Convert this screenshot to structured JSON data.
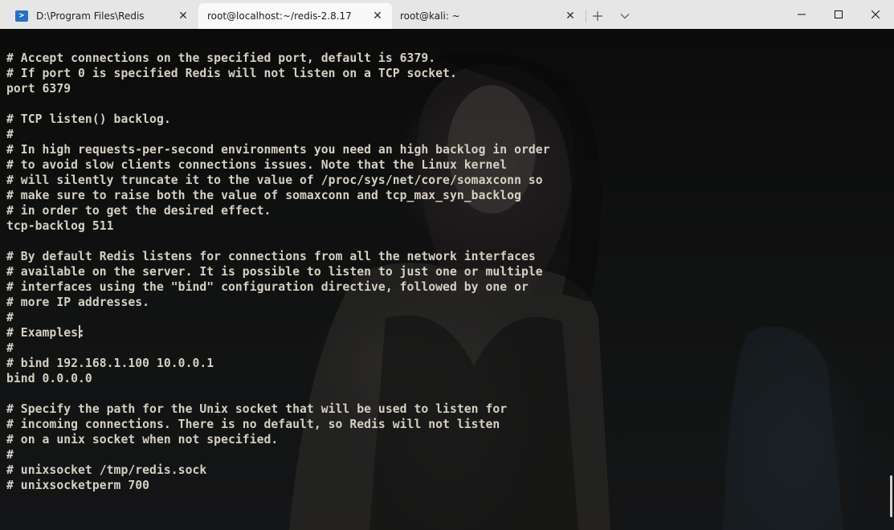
{
  "tabs": [
    {
      "label": "D:\\Program Files\\Redis",
      "icon": "powershell-icon",
      "active": false
    },
    {
      "label": "root@localhost:~/redis-2.8.17",
      "active": true
    },
    {
      "label": "root@kali: ~",
      "active": false
    }
  ],
  "tab_close_glyph": "✕",
  "ps_icon_glyph": ">",
  "colors": {
    "tabbar_bg": "#e6e6e6",
    "active_tab_bg": "#f9f9f9",
    "terminal_bg": "#0c0c0c",
    "terminal_fg": "#d6d0c2",
    "ps_icon": "#2671be"
  },
  "terminal": {
    "lines": [
      "# Accept connections on the specified port, default is 6379.",
      "# If port 0 is specified Redis will not listen on a TCP socket.",
      "port 6379",
      "",
      "# TCP listen() backlog.",
      "#",
      "# In high requests-per-second environments you need an high backlog in order",
      "# to avoid slow clients connections issues. Note that the Linux kernel",
      "# will silently truncate it to the value of /proc/sys/net/core/somaxconn so",
      "# make sure to raise both the value of somaxconn and tcp_max_syn_backlog",
      "# in order to get the desired effect.",
      "tcp-backlog 511",
      "",
      "# By default Redis listens for connections from all the network interfaces",
      "# available on the server. It is possible to listen to just one or multiple",
      "# interfaces using the \"bind\" configuration directive, followed by one or",
      "# more IP addresses.",
      "#",
      "# Examples:",
      "#",
      "# bind 192.168.1.100 10.0.0.1",
      "bind 0.0.0.0",
      "",
      "# Specify the path for the Unix socket that will be used to listen for",
      "# incoming connections. There is no default, so Redis will not listen",
      "# on a unix socket when not specified.",
      "#",
      "# unixsocket /tmp/redis.sock",
      "# unixsocketperm 700"
    ]
  }
}
